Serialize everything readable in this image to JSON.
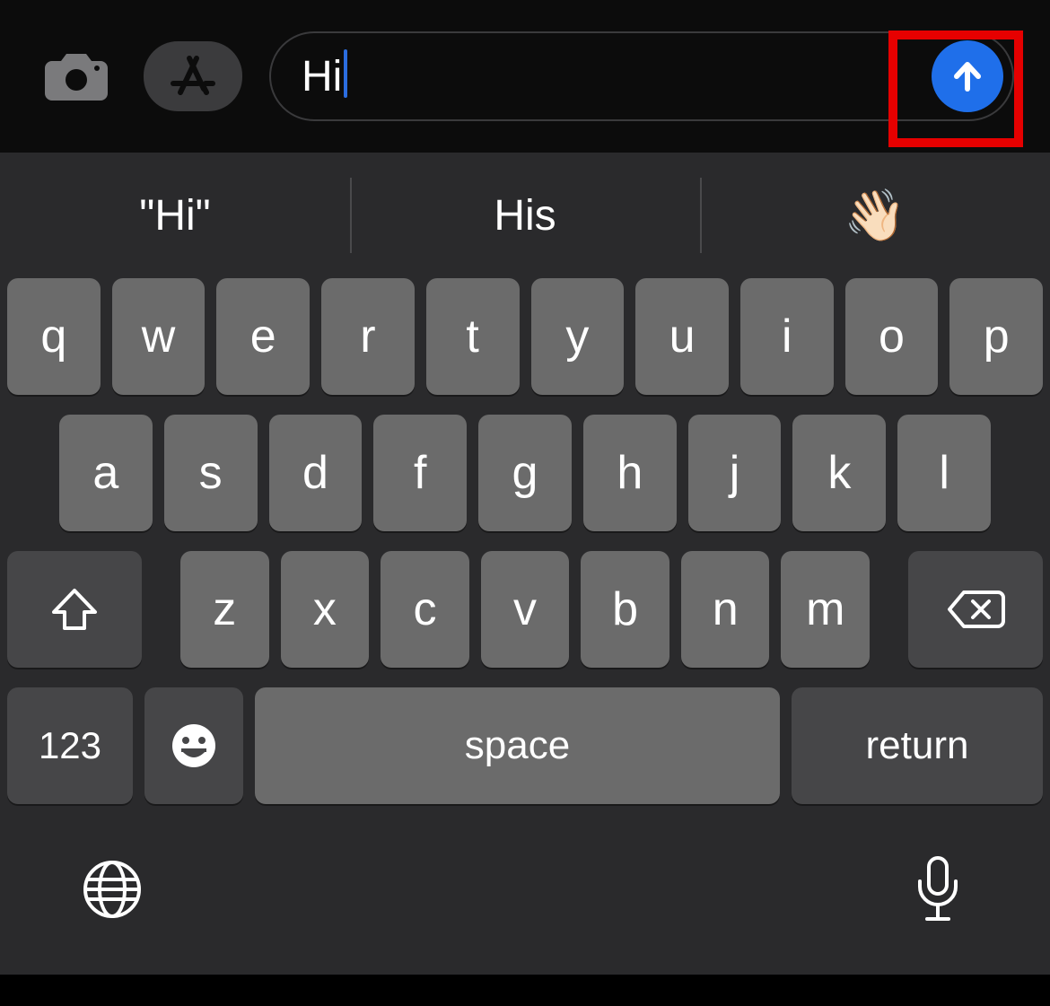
{
  "compose": {
    "text": "Hi",
    "send_color": "#1f6fea"
  },
  "suggestions": {
    "item1": "\"Hi\"",
    "item2": "His",
    "item3": "👋🏻"
  },
  "keyboard": {
    "row1": [
      "q",
      "w",
      "e",
      "r",
      "t",
      "y",
      "u",
      "i",
      "o",
      "p"
    ],
    "row2": [
      "a",
      "s",
      "d",
      "f",
      "g",
      "h",
      "j",
      "k",
      "l"
    ],
    "row3": [
      "z",
      "x",
      "c",
      "v",
      "b",
      "n",
      "m"
    ],
    "numkey": "123",
    "space": "space",
    "return": "return"
  }
}
